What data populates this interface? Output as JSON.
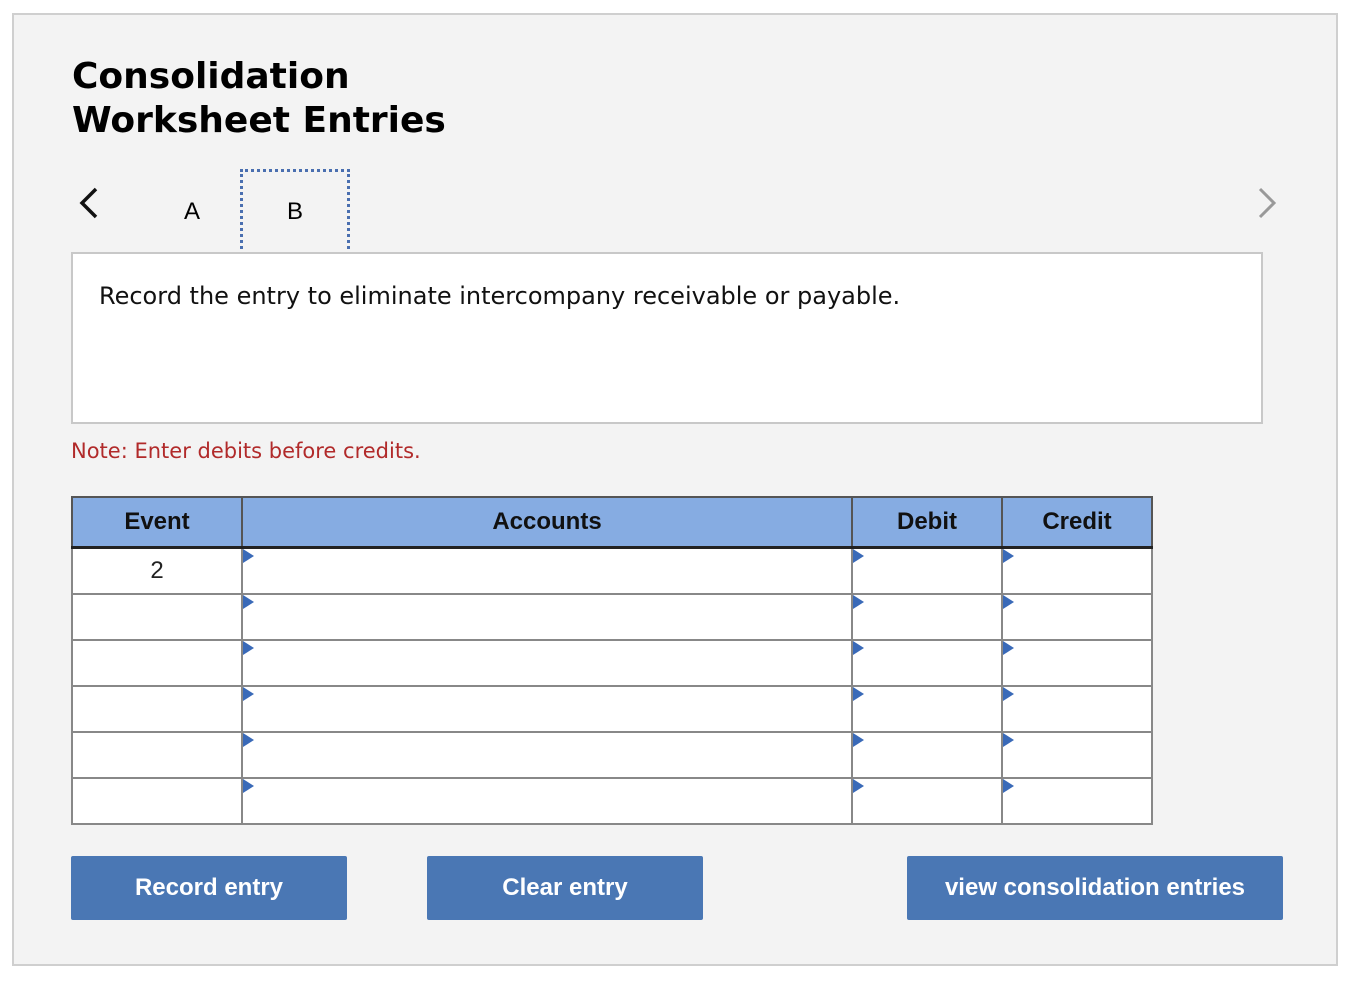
{
  "title": {
    "line1": "Consolidation",
    "line2": "Worksheet Entries"
  },
  "tabs": [
    {
      "label": "A"
    },
    {
      "label": "B"
    }
  ],
  "question": "Record the entry to eliminate intercompany receivable or payable.",
  "note": "Note: Enter debits before credits.",
  "table": {
    "headers": {
      "event": "Event",
      "accounts": "Accounts",
      "debit": "Debit",
      "credit": "Credit"
    },
    "rows": [
      {
        "event": "2",
        "account": "",
        "debit": "",
        "credit": ""
      },
      {
        "event": "",
        "account": "",
        "debit": "",
        "credit": ""
      },
      {
        "event": "",
        "account": "",
        "debit": "",
        "credit": ""
      },
      {
        "event": "",
        "account": "",
        "debit": "",
        "credit": ""
      },
      {
        "event": "",
        "account": "",
        "debit": "",
        "credit": ""
      },
      {
        "event": "",
        "account": "",
        "debit": "",
        "credit": ""
      }
    ]
  },
  "buttons": {
    "record": "Record entry",
    "clear": "Clear entry",
    "view": "view consolidation entries"
  },
  "colors": {
    "accent": "#4a77b4",
    "header_bg": "#86ace2",
    "note": "#b12a2a",
    "panel_bg": "#f3f3f3"
  },
  "icons": {
    "prev": "chevron-left-icon",
    "next": "chevron-right-icon",
    "dropdown": "dropdown-triangle-icon"
  }
}
